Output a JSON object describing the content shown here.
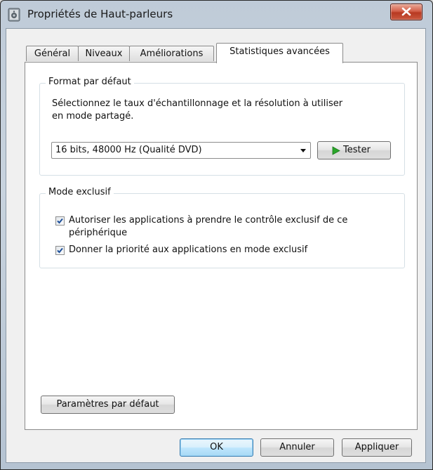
{
  "window": {
    "title": "Propriétés de Haut-parleurs"
  },
  "tabs": [
    {
      "label": "Général"
    },
    {
      "label": "Niveaux"
    },
    {
      "label": "Améliorations"
    },
    {
      "label": "Statistiques avancées"
    }
  ],
  "format_group": {
    "legend": "Format par défaut",
    "description_line1": "Sélectionnez le taux d'échantillonnage et la résolution à utiliser",
    "description_line2": "en mode partagé.",
    "select_value": "16 bits, 48000 Hz (Qualité DVD)",
    "test_button": "Tester"
  },
  "exclusive_group": {
    "legend": "Mode exclusif",
    "option1_line1": "Autoriser les applications à prendre le contrôle exclusif de ce",
    "option1_line2": "périphérique",
    "option1_checked": true,
    "option2": "Donner la priorité aux applications en mode exclusif",
    "option2_checked": true
  },
  "restore_defaults_button": "Paramètres par défaut",
  "footer": {
    "ok": "OK",
    "cancel": "Annuler",
    "apply": "Appliquer"
  },
  "colors": {
    "play_icon": "#2aa62a",
    "close_button": "#c9573e",
    "default_button_border": "#3c7fb1"
  }
}
